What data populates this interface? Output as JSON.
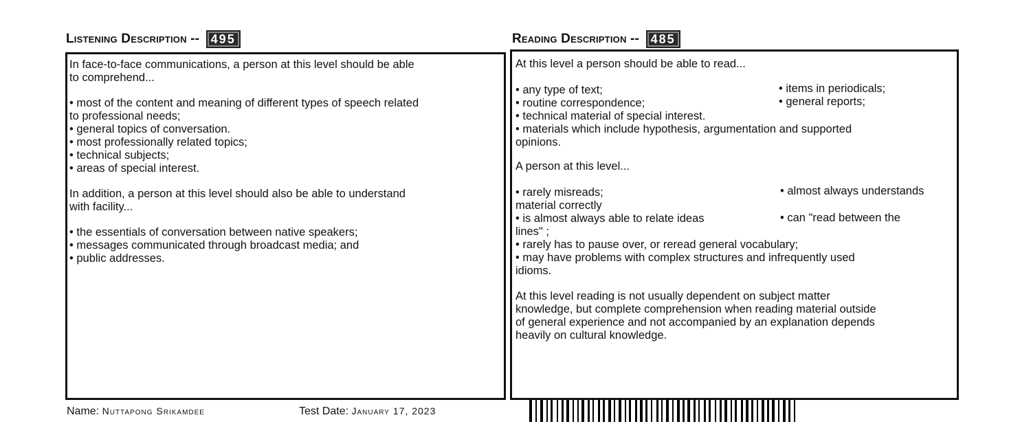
{
  "listening": {
    "heading": "Listening Description --",
    "score": "495",
    "lines": [
      "In face-to-face communications, a person at this level should be able",
      "to comprehend...",
      "",
      "• most of the content and meaning of different types of speech related",
      "to professional needs;",
      "• general topics of conversation.",
      "• most  professionally related topics;",
      "• technical subjects;",
      "• areas of special interest.",
      "",
      "In addition, a person at this level should also be able to understand",
      "with facility...",
      "",
      "• the essentials of conversation between native speakers;",
      "• messages communicated through broadcast media; and",
      "• public addresses."
    ]
  },
  "reading": {
    "heading": "Reading Description --",
    "score": "485",
    "intro": "At this level a person should be able to read...",
    "left_lines": [
      "• any type of text;",
      "• routine correspondence;",
      "• technical material of special interest.",
      "• materials which include hypothesis, argumentation and supported",
      "opinions."
    ],
    "right_lines": [
      "•  items in periodicals;",
      "• general reports;"
    ],
    "person_intro": "A person at this level...",
    "person_left_lines": [
      "• rarely misreads;",
      "material correctly",
      "• is almost always able to relate ideas",
      "lines\" ;",
      "• rarely has to pause over, or reread general vocabulary;",
      "•  may have problems with complex structures and infrequently used",
      "idioms."
    ],
    "person_right_1": "• almost always understands",
    "person_right_2": "• can \"read between the",
    "closing_lines": [
      "At this level reading is not usually dependent on subject matter",
      "knowledge, but complete comprehension when reading material outside",
      "of general experience and not accompanied by an explanation depends",
      "heavily on cultural knowledge."
    ]
  },
  "footer": {
    "name_label": "Name:",
    "name_value": "Nuttapong Srikamdee",
    "date_label": "Test Date:",
    "date_value": "January 17, 2023"
  }
}
